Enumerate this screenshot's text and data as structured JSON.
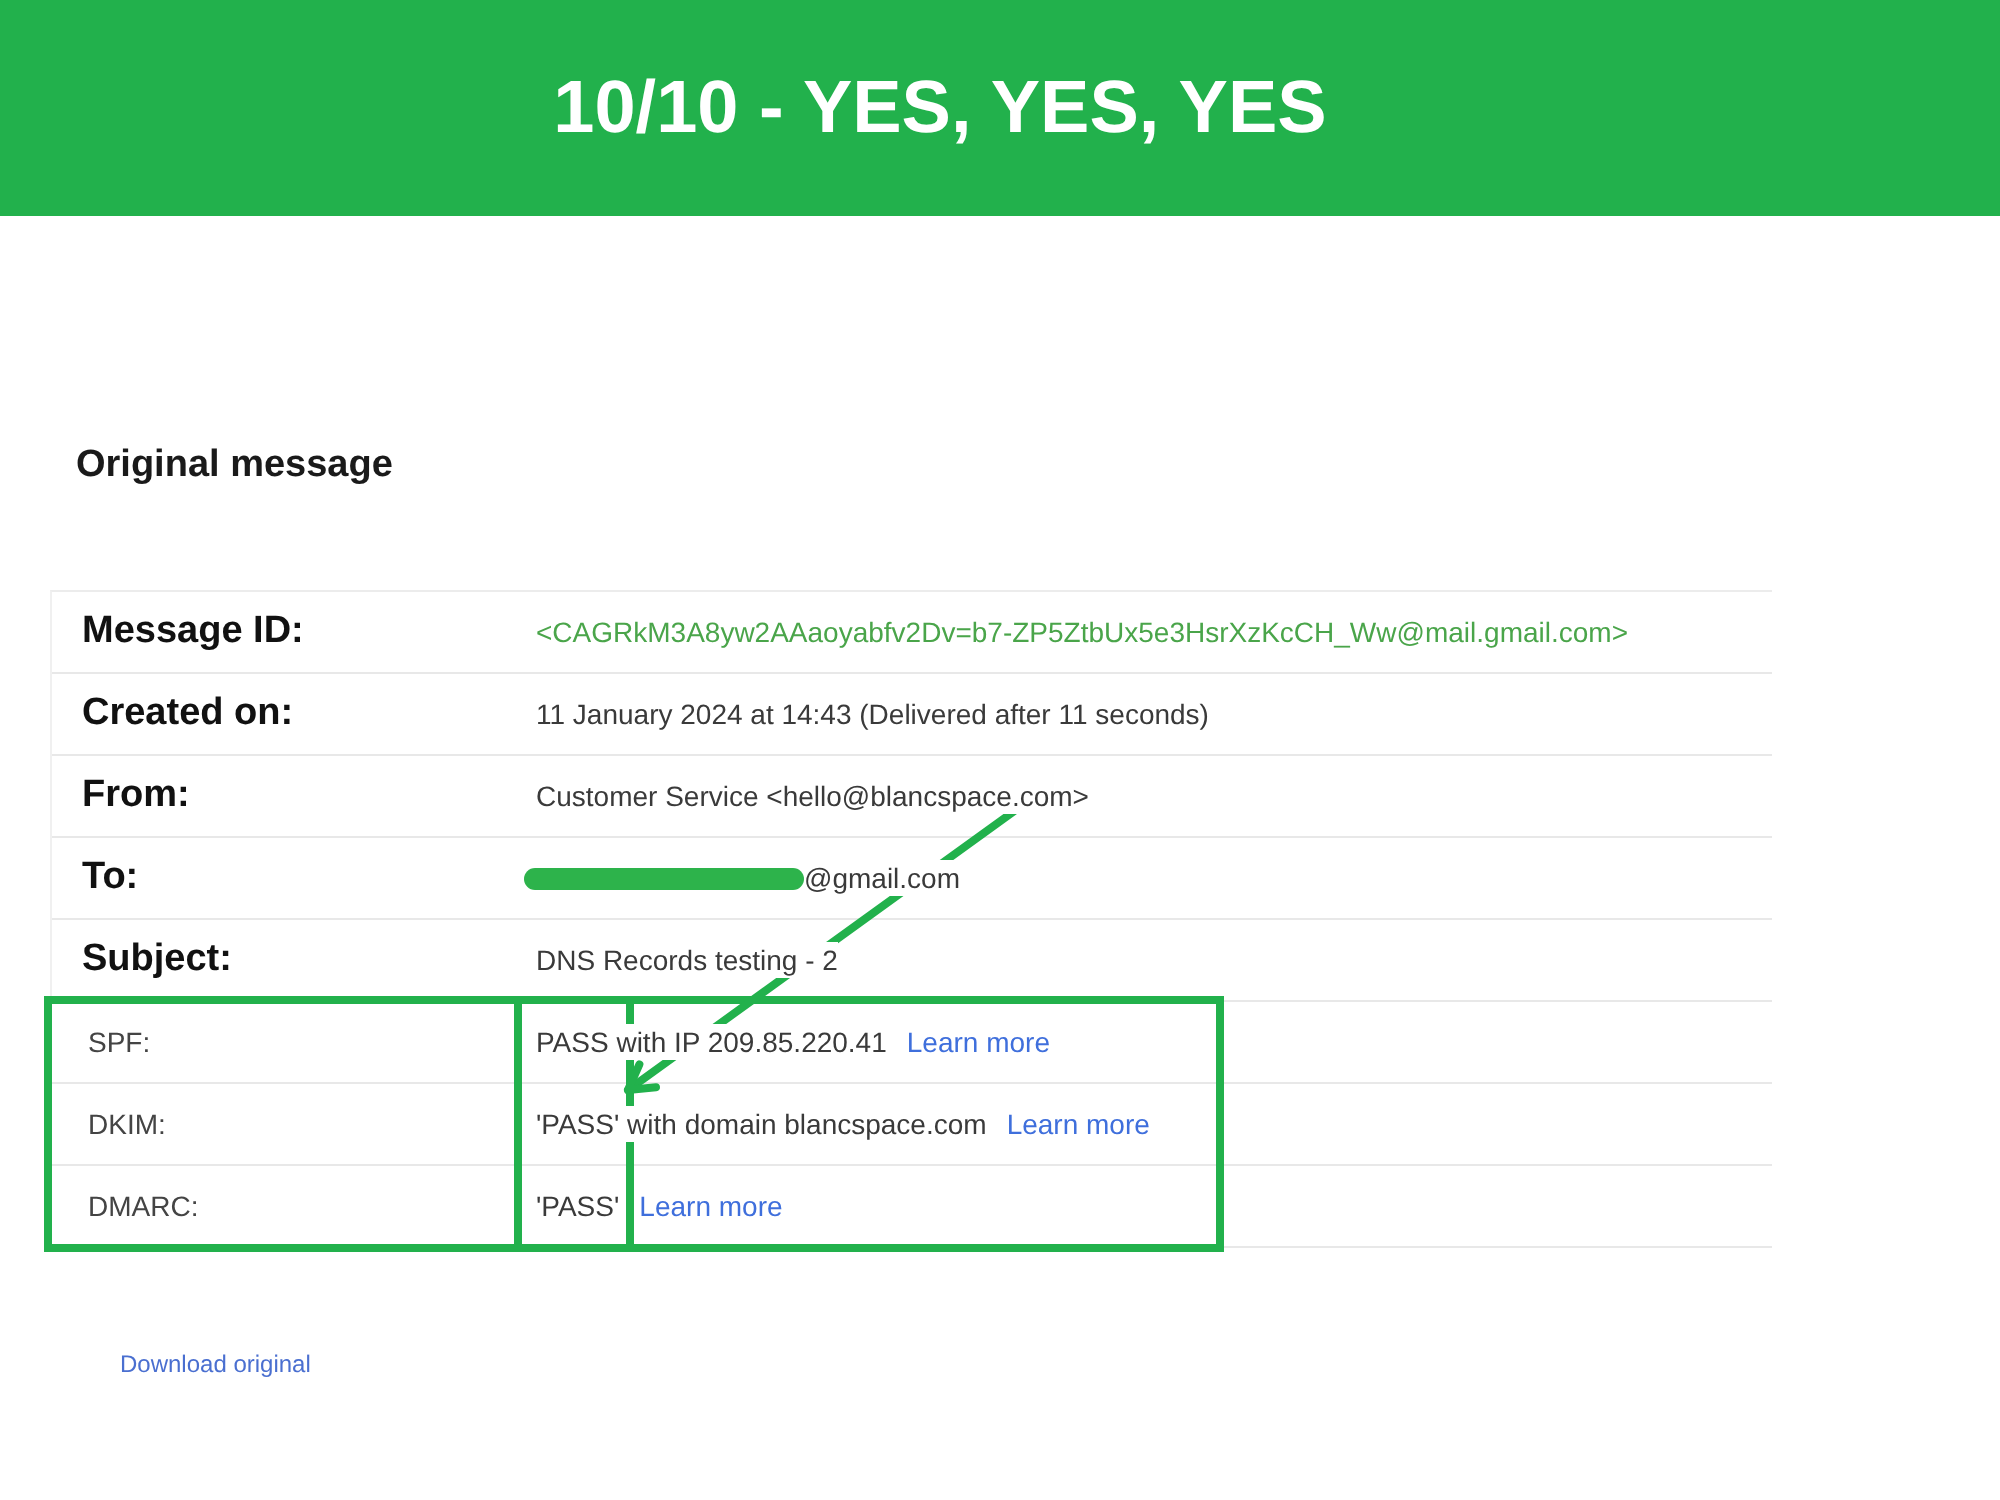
{
  "banner": {
    "title": "10/10 - YES, YES, YES"
  },
  "heading": "Original message",
  "details": [
    {
      "kind": "id",
      "label": "Message ID:",
      "value": "<CAGRkM3A8yw2AAaoyabfv2Dv=b7-ZP5ZtbUx5e3HsrXzKcCH_Ww@mail.gmail.com>"
    },
    {
      "kind": "text",
      "label": "Created on:",
      "value": "11 January 2024 at 14:43 (Delivered after 11 seconds)"
    },
    {
      "kind": "text",
      "label": "From:",
      "value": "Customer Service <hello@blancspace.com>"
    },
    {
      "kind": "redacted",
      "label": "To:",
      "value": "@gmail.com"
    },
    {
      "kind": "text",
      "label": "Subject:",
      "value": "DNS Records testing - 2"
    }
  ],
  "auth_results": [
    {
      "label": "SPF:",
      "result": "PASS with IP 209.85.220.41",
      "link": "Learn more"
    },
    {
      "label": "DKIM:",
      "result": "'PASS' with domain blancspace.com",
      "link": "Learn more"
    },
    {
      "label": "DMARC:",
      "result": "'PASS'",
      "link": "Learn more"
    }
  ],
  "download_link": "Download original"
}
